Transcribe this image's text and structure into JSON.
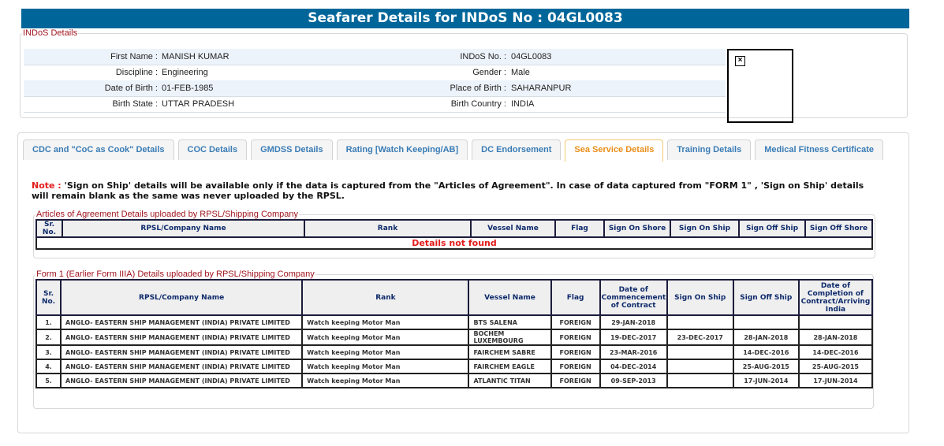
{
  "header": {
    "title": "Seafarer Details for INDoS No : 04GL0083"
  },
  "indos": {
    "legend": "INDoS Details",
    "rows": [
      {
        "l1": "First Name :",
        "v1": "MANISH KUMAR",
        "l2": "INDoS No. :",
        "v2": "04GL0083"
      },
      {
        "l1": "Discipline :",
        "v1": "Engineering",
        "l2": "Gender :",
        "v2": "Male"
      },
      {
        "l1": "Date of Birth :",
        "v1": "01-FEB-1985",
        "l2": "Place of Birth :",
        "v2": "SAHARANPUR"
      },
      {
        "l1": "Birth State :",
        "v1": "UTTAR PRADESH",
        "l2": "Birth Country :",
        "v2": "INDIA"
      }
    ],
    "photo_icon": "broken-image-icon"
  },
  "tabs": [
    {
      "label": "CDC and \"CoC as Cook\" Details"
    },
    {
      "label": "COC Details"
    },
    {
      "label": "GMDSS Details"
    },
    {
      "label": "Rating [Watch Keeping/AB]"
    },
    {
      "label": "DC Endorsement"
    },
    {
      "label": "Sea Service Details",
      "active": true
    },
    {
      "label": "Training Details"
    },
    {
      "label": "Medical Fitness Certificate"
    }
  ],
  "note": {
    "prefix": "Note :",
    "text": " 'Sign on Ship' details will be available only if the data is captured from the \"Articles of Agreement\". In case of data captured from \"FORM 1\" , 'Sign on Ship' details will remain blank as the same was never uploaded by the RPSL."
  },
  "aoa": {
    "legend": "Articles of Agreement Details uploaded by RPSL/Shipping Company",
    "columns": [
      "Sr. No.",
      "RPSL/Company Name",
      "Rank",
      "Vessel Name",
      "Flag",
      "Sign On Shore",
      "Sign On Ship",
      "Sign Off Ship",
      "Sign Off Shore"
    ],
    "empty": "Details not found"
  },
  "form1": {
    "legend": "Form 1 (Earlier Form IIIA) Details uploaded by RPSL/Shipping Company",
    "columns": [
      "Sr. No.",
      "RPSL/Company Name",
      "Rank",
      "Vessel Name",
      "Flag",
      "Date of Commencement of Contract",
      "Sign On Ship",
      "Sign Off Ship",
      "Date of Completion of Contract/Arriving India"
    ],
    "rows": [
      [
        "1.",
        "ANGLO- EASTERN SHIP MANAGEMENT (INDIA) PRIVATE LIMITED",
        "Watch keeping Motor Man",
        "BTS SALENA",
        "FOREIGN",
        "29-JAN-2018",
        "",
        "",
        ""
      ],
      [
        "2.",
        "ANGLO- EASTERN SHIP MANAGEMENT (INDIA) PRIVATE LIMITED",
        "Watch keeping Motor Man",
        "BOCHEM LUXEMBOURG",
        "FOREIGN",
        "19-DEC-2017",
        "23-DEC-2017",
        "28-JAN-2018",
        "28-JAN-2018"
      ],
      [
        "3.",
        "ANGLO- EASTERN SHIP MANAGEMENT (INDIA) PRIVATE LIMITED",
        "Watch keeping Motor Man",
        "FAIRCHEM SABRE",
        "FOREIGN",
        "23-MAR-2016",
        "",
        "14-DEC-2016",
        "14-DEC-2016"
      ],
      [
        "4.",
        "ANGLO- EASTERN SHIP MANAGEMENT (INDIA) PRIVATE LIMITED",
        "Watch keeping Motor Man",
        "FAIRCHEM EAGLE",
        "FOREIGN",
        "04-DEC-2014",
        "",
        "25-AUG-2015",
        "25-AUG-2015"
      ],
      [
        "5.",
        "ANGLO- EASTERN SHIP MANAGEMENT (INDIA) PRIVATE LIMITED",
        "Watch keeping Motor Man",
        "ATLANTIC TITAN",
        "FOREIGN",
        "09-SEP-2013",
        "",
        "17-JUN-2014",
        "17-JUN-2014"
      ]
    ]
  }
}
